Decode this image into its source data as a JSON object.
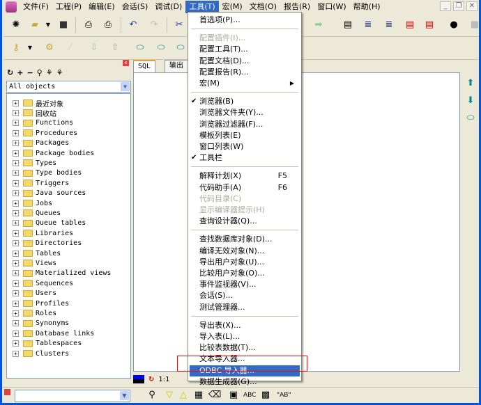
{
  "menubar": {
    "items": [
      "文件(F)",
      "工程(P)",
      "编辑(E)",
      "会话(S)",
      "调试(D)",
      "工具(T)",
      "宏(M)",
      "文档(O)",
      "报告(R)",
      "窗口(W)",
      "帮助(H)"
    ],
    "active_index": 5
  },
  "window_controls": {
    "minimize": "_",
    "restore": "❐",
    "close": "✕"
  },
  "browser": {
    "filter": "All objects",
    "nodes": [
      "最近对象",
      "回收站",
      "Functions",
      "Procedures",
      "Packages",
      "Package bodies",
      "Types",
      "Type bodies",
      "Triggers",
      "Java sources",
      "Jobs",
      "Queues",
      "Queue tables",
      "Libraries",
      "Directories",
      "Tables",
      "Views",
      "Materialized views",
      "Sequences",
      "Users",
      "Profiles",
      "Roles",
      "Synonyms",
      "Database links",
      "Tablespaces",
      "Clusters"
    ]
  },
  "editor": {
    "tabs": [
      "SQL",
      "输出"
    ],
    "position": "1:1"
  },
  "tools_menu": [
    {
      "label": "首选项(P)..."
    },
    {
      "sep": true
    },
    {
      "label": "配置插件(I)...",
      "disabled": true
    },
    {
      "label": "配置工具(T)..."
    },
    {
      "label": "配置文档(D)..."
    },
    {
      "label": "配置报告(R)..."
    },
    {
      "label": "宏(M)",
      "submenu": true
    },
    {
      "sep": true
    },
    {
      "label": "浏览器(B)",
      "checked": true
    },
    {
      "label": "浏览器文件夹(Y)..."
    },
    {
      "label": "浏览器过滤器(F)..."
    },
    {
      "label": "模板列表(E)"
    },
    {
      "label": "窗口列表(W)"
    },
    {
      "label": "工具栏",
      "checked": true
    },
    {
      "sep": true
    },
    {
      "label": "解释计划(X)",
      "shortcut": "F5"
    },
    {
      "label": "代码助手(A)",
      "shortcut": "F6"
    },
    {
      "label": "代码目录(C)",
      "disabled": true
    },
    {
      "label": "显示编译器提示(H)",
      "disabled": true
    },
    {
      "label": "查询设计器(Q)..."
    },
    {
      "sep": true
    },
    {
      "label": "查找数据库对象(D)..."
    },
    {
      "label": "编译无效对象(N)..."
    },
    {
      "label": "导出用户对象(U)..."
    },
    {
      "label": "比较用户对象(O)..."
    },
    {
      "label": "事件监视器(V)..."
    },
    {
      "label": "会话(S)..."
    },
    {
      "label": "测试管理器..."
    },
    {
      "sep": true
    },
    {
      "label": "导出表(X)..."
    },
    {
      "label": "导入表(L)..."
    },
    {
      "label": "比较表数据(T)..."
    },
    {
      "label": "文本导入器..."
    },
    {
      "label": "ODBC 导入器...",
      "highlighted": true
    },
    {
      "label": "数据生成器(G)..."
    }
  ],
  "find_bar": {
    "input": "",
    "labels": [
      "ABC",
      "\"AB\""
    ]
  },
  "colors": {
    "highlight": "#316ac5",
    "title": "#0054e3",
    "annotation": "#ff0000"
  }
}
